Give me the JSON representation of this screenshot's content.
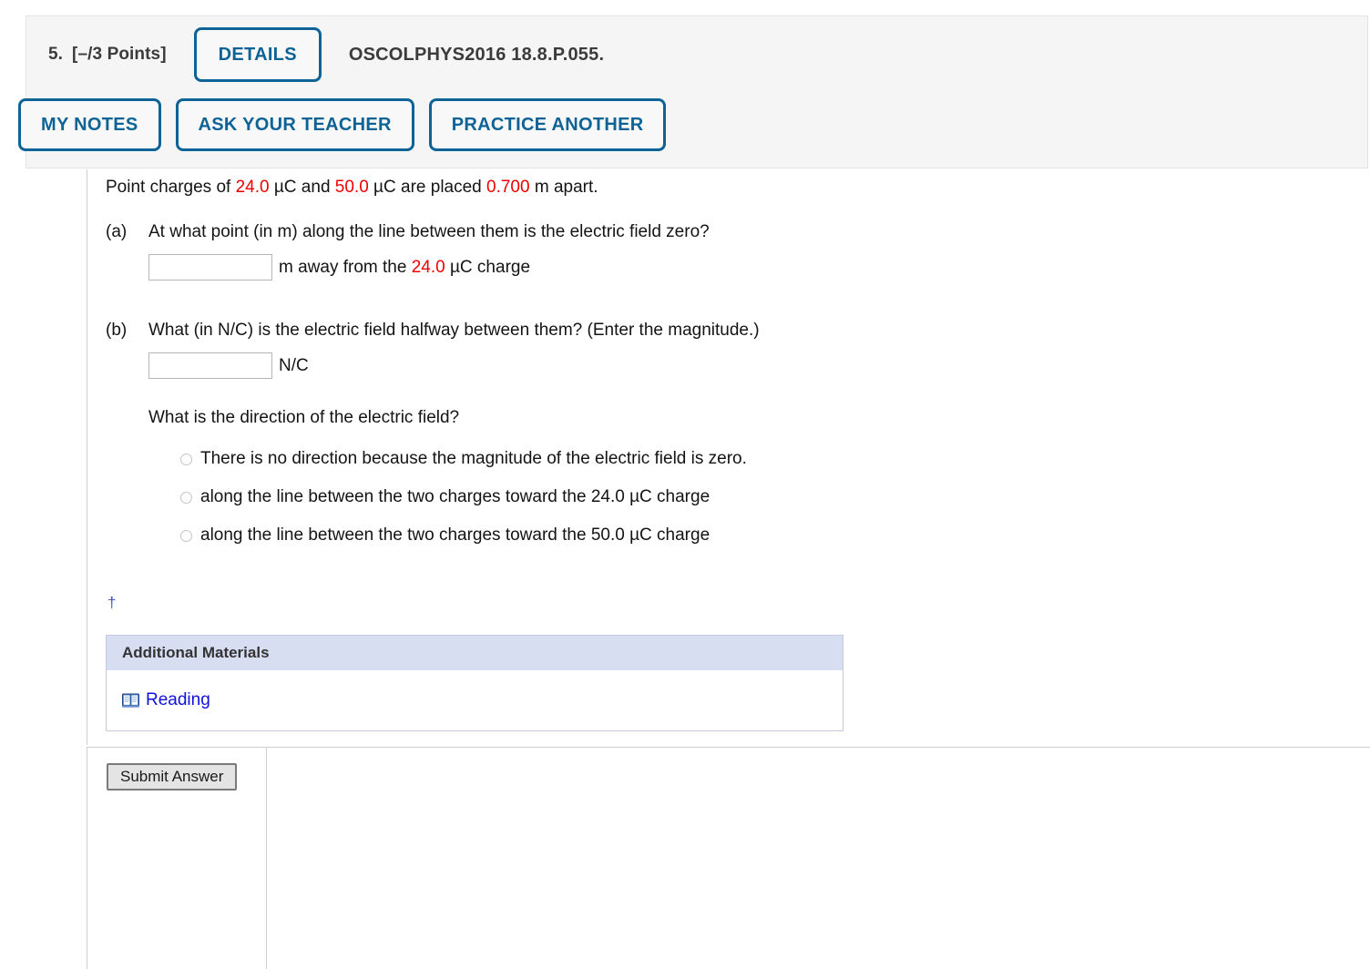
{
  "header": {
    "question_number": "5.",
    "points": "[–/3 Points]",
    "details_button": "DETAILS",
    "question_code": "OSCOLPHYS2016 18.8.P.055.",
    "buttons": [
      {
        "label": "MY NOTES",
        "name": "my-notes-button"
      },
      {
        "label": "ASK YOUR TEACHER",
        "name": "ask-your-teacher-button"
      },
      {
        "label": "PRACTICE ANOTHER",
        "name": "practice-another-button"
      }
    ],
    "accent_color": "#0e6396",
    "panel_color": "#f5f5f5"
  },
  "question": {
    "stem": {
      "text_1": "Point charges of ",
      "charge_1": "24.0",
      "text_2": " µC and ",
      "charge_2": "50.0",
      "text_3": " µC are placed ",
      "distance": "0.700",
      "text_4": " m apart."
    },
    "value_color": "#ee0000",
    "parts": [
      {
        "label": "(a)",
        "prompt": "At what point (in m) along the line between them is the electric field zero?",
        "input_value": "",
        "input_placeholder": "",
        "unit_prefix": "m away from the ",
        "unit_charge": "24.0",
        "unit_suffix": " µC charge"
      },
      {
        "label": "(b)",
        "prompt": "What (in N/C) is the electric field halfway between them? (Enter the magnitude.)",
        "input_value": "",
        "input_placeholder": "",
        "unit": "N/C",
        "subquestion": "What is the direction of the electric field?",
        "options": [
          "There is no direction because the magnitude of the electric field is zero.",
          "along the line between the two charges toward the 24.0 µC charge",
          "along the line between the two charges toward the 50.0 µC charge"
        ]
      }
    ],
    "footnote_marker": "†"
  },
  "additional_materials": {
    "title": "Additional Materials",
    "header_color": "#d7def2",
    "links": [
      {
        "label": "Reading",
        "icon": "book-icon",
        "color": "#1111dd"
      }
    ]
  },
  "footer": {
    "submit_label": "Submit Answer"
  }
}
